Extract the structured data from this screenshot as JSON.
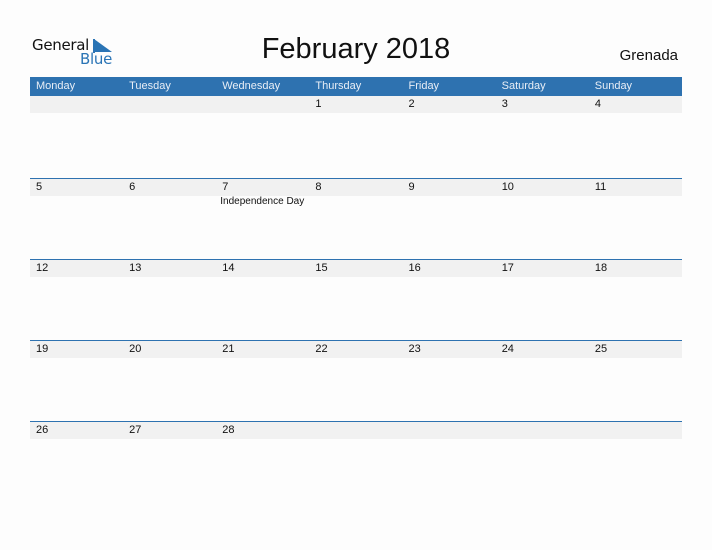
{
  "logo": {
    "general": "General",
    "blue": "Blue"
  },
  "title": "February 2018",
  "country": "Grenada",
  "weekdays": [
    "Monday",
    "Tuesday",
    "Wednesday",
    "Thursday",
    "Friday",
    "Saturday",
    "Sunday"
  ],
  "weeks": [
    {
      "days": [
        "",
        "",
        "",
        "1",
        "2",
        "3",
        "4"
      ],
      "events": [
        "",
        "",
        "",
        "",
        "",
        "",
        ""
      ]
    },
    {
      "days": [
        "5",
        "6",
        "7",
        "8",
        "9",
        "10",
        "11"
      ],
      "events": [
        "",
        "",
        "Independence Day",
        "",
        "",
        "",
        ""
      ]
    },
    {
      "days": [
        "12",
        "13",
        "14",
        "15",
        "16",
        "17",
        "18"
      ],
      "events": [
        "",
        "",
        "",
        "",
        "",
        "",
        ""
      ]
    },
    {
      "days": [
        "19",
        "20",
        "21",
        "22",
        "23",
        "24",
        "25"
      ],
      "events": [
        "",
        "",
        "",
        "",
        "",
        "",
        ""
      ]
    },
    {
      "days": [
        "26",
        "27",
        "28",
        "",
        "",
        "",
        ""
      ],
      "events": [
        "",
        "",
        "",
        "",
        "",
        "",
        ""
      ]
    }
  ],
  "colors": {
    "accent": "#2e72b0",
    "strip": "#f1f1f1"
  }
}
